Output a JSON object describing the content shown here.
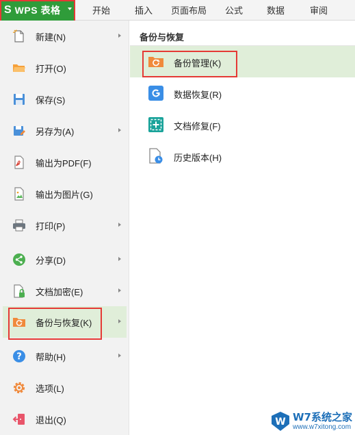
{
  "ribbon": {
    "app_logo_letter": "S",
    "app_name": "WPS 表格",
    "tabs": [
      "开始",
      "插入",
      "页面布局",
      "公式",
      "数据",
      "审阅"
    ]
  },
  "file_menu": {
    "items": [
      {
        "label": "新建(N)",
        "icon": "new-file-icon",
        "has_submenu": true
      },
      {
        "label": "打开(O)",
        "icon": "folder-open-icon",
        "has_submenu": false
      },
      {
        "label": "保存(S)",
        "icon": "save-icon",
        "has_submenu": false
      },
      {
        "label": "另存为(A)",
        "icon": "save-as-icon",
        "has_submenu": true
      },
      {
        "label": "输出为PDF(F)",
        "icon": "pdf-export-icon",
        "has_submenu": false
      },
      {
        "label": "输出为图片(G)",
        "icon": "image-export-icon",
        "has_submenu": false
      },
      {
        "label": "打印(P)",
        "icon": "printer-icon",
        "has_submenu": true
      },
      {
        "label": "分享(D)",
        "icon": "share-icon",
        "has_submenu": true
      },
      {
        "label": "文档加密(E)",
        "icon": "lock-document-icon",
        "has_submenu": true
      },
      {
        "label": "备份与恢复(K)",
        "icon": "backup-folder-icon",
        "has_submenu": true,
        "active": true
      },
      {
        "label": "帮助(H)",
        "icon": "help-icon",
        "has_submenu": true
      },
      {
        "label": "选项(L)",
        "icon": "gear-icon",
        "has_submenu": false
      },
      {
        "label": "退出(Q)",
        "icon": "exit-icon",
        "has_submenu": false
      }
    ]
  },
  "submenu": {
    "title": "备份与恢复",
    "items": [
      {
        "label": "备份管理(K)",
        "icon": "backup-folder-icon",
        "active": true
      },
      {
        "label": "数据恢复(R)",
        "icon": "data-recovery-icon"
      },
      {
        "label": "文档修复(F)",
        "icon": "document-repair-icon"
      },
      {
        "label": "历史版本(H)",
        "icon": "history-version-icon"
      }
    ]
  },
  "watermark": {
    "logo": "W",
    "text": "W7系统之家",
    "url": "www.w7xitong.com"
  },
  "colors": {
    "brand_green": "#2f9c3a",
    "active_row": "#e0eed9",
    "highlight_red": "#e53935",
    "icon_orange": "#f08a3c",
    "icon_blue": "#3a8ee6",
    "icon_teal": "#1aa39a",
    "watermark_blue": "#1d6fb8"
  }
}
